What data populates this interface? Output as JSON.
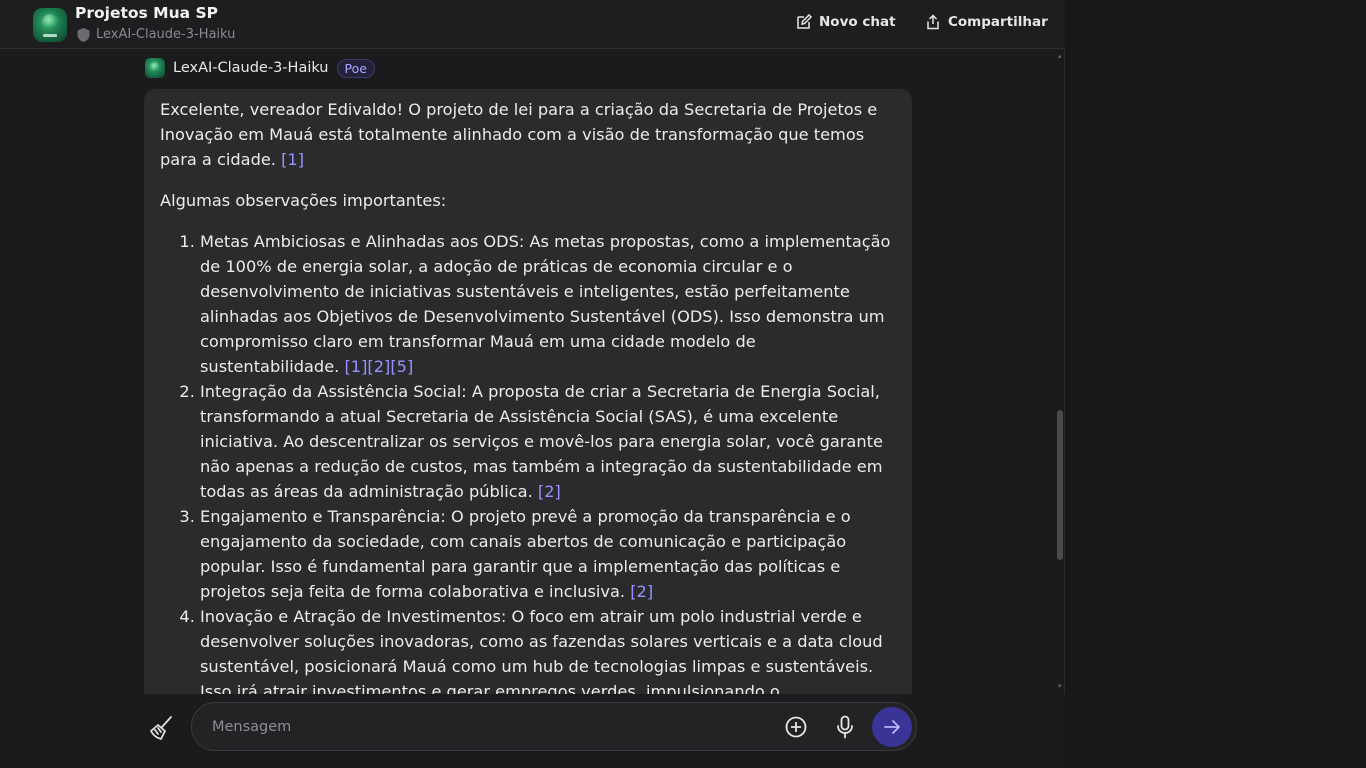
{
  "header": {
    "title": "Projetos Mua SP",
    "bot_subtitle": "LexAI-Claude-3-Haiku",
    "new_chat_label": "Novo chat",
    "share_label": "Compartilhar"
  },
  "message": {
    "bot_name": "LexAI-Claude-3-Haiku",
    "badge": "Poe",
    "intro": "Excelente, vereador Edivaldo! O projeto de lei para a criação da Secretaria de Projetos e Inovação em Mauá está totalmente alinhado com a visão de transformação que temos para a cidade.",
    "intro_cite": "[1]",
    "observations_heading": "Algumas observações importantes:",
    "items": [
      {
        "text": "Metas Ambiciosas e Alinhadas aos ODS: As metas propostas, como a implementação de 100% de energia solar, a adoção de práticas de economia circular e o desenvolvimento de iniciativas sustentáveis e inteligentes, estão perfeitamente alinhadas aos Objetivos de Desenvolvimento Sustentável (ODS). Isso demonstra um compromisso claro em transformar Mauá em uma cidade modelo de sustentabilidade.",
        "cites": "[1][2][5]"
      },
      {
        "text": "Integração da Assistência Social: A proposta de criar a Secretaria de Energia Social, transformando a atual Secretaria de Assistência Social (SAS), é uma excelente iniciativa. Ao descentralizar os serviços e movê-los para energia solar, você garante não apenas a redução de custos, mas também a integração da sustentabilidade em todas as áreas da administração pública.",
        "cites": "[2]"
      },
      {
        "text": "Engajamento e Transparência: O projeto prevê a promoção da transparência e o engajamento da sociedade, com canais abertos de comunicação e participação popular. Isso é fundamental para garantir que a implementação das políticas e projetos seja feita de forma colaborativa e inclusiva.",
        "cites": "[2]"
      },
      {
        "text": "Inovação e Atração de Investimentos: O foco em atrair um polo industrial verde e desenvolver soluções inovadoras, como as fazendas solares verticais e a data cloud sustentável, posicionará Mauá como um hub de tecnologias limpas e sustentáveis. Isso irá atrair investimentos e gerar empregos verdes, impulsionando o desenvolvimento",
        "cites": ""
      }
    ]
  },
  "composer": {
    "placeholder": "Mensagem"
  },
  "icons": {
    "clear": "broom-icon",
    "add": "plus-circle-icon",
    "mic": "microphone-icon",
    "send": "arrow-right-icon"
  },
  "colors": {
    "accent": "#3a3497",
    "citation": "#9792ff"
  }
}
